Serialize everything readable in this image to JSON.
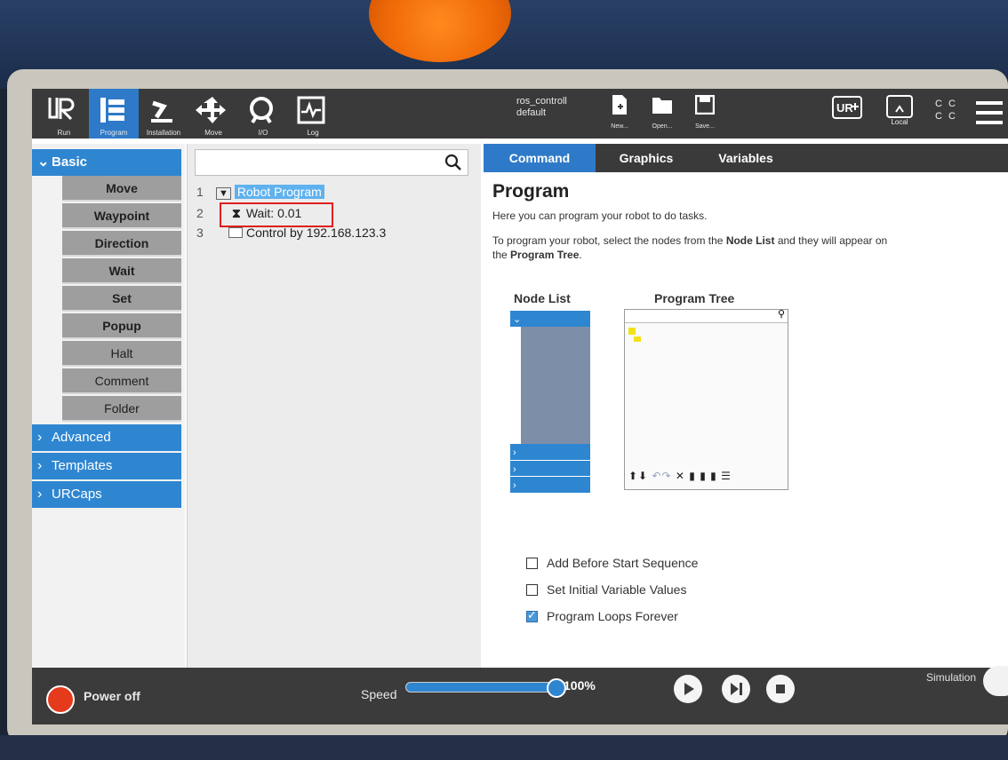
{
  "header": {
    "nav": [
      {
        "label": "Run",
        "icon": "ur-logo-icon"
      },
      {
        "label": "Program",
        "icon": "program-icon",
        "active": true
      },
      {
        "label": "Installation",
        "icon": "installation-icon"
      },
      {
        "label": "Move",
        "icon": "move-icon"
      },
      {
        "label": "I/O",
        "icon": "io-icon"
      },
      {
        "label": "Log",
        "icon": "log-icon"
      }
    ],
    "program_name": "ros_controll",
    "installation_name": "default",
    "file_buttons": [
      {
        "label": "New...",
        "icon": "new-file-icon"
      },
      {
        "label": "Open...",
        "icon": "open-folder-icon"
      },
      {
        "label": "Save...",
        "icon": "save-icon"
      }
    ],
    "local_label": "Local",
    "cc_top": "C C",
    "cc_bottom": "C C"
  },
  "sidebar": {
    "categories": [
      {
        "label": "Basic",
        "expanded": true
      },
      {
        "label": "Advanced"
      },
      {
        "label": "Templates"
      },
      {
        "label": "URCaps"
      }
    ],
    "basic_items": [
      "Move",
      "Waypoint",
      "Direction",
      "Wait",
      "Set",
      "Popup",
      "Halt",
      "Comment",
      "Folder"
    ]
  },
  "tree": {
    "rows": [
      {
        "num": "1",
        "label": "Robot Program",
        "selected": true
      },
      {
        "num": "2",
        "label": "Wait: 0.01"
      },
      {
        "num": "3",
        "label": "Control by 192.168.123.3"
      }
    ]
  },
  "tabs": [
    {
      "label": "Command",
      "active": true
    },
    {
      "label": "Graphics"
    },
    {
      "label": "Variables"
    }
  ],
  "command": {
    "title": "Program",
    "line1": "Here you can program your robot to do tasks.",
    "line2_a": "To program your robot, select the nodes from the ",
    "line2_b": "Node List",
    "line2_c": " and they will appear on",
    "line3_a": "the ",
    "line3_b": "Program Tree",
    "line3_c": ".",
    "node_list_title": "Node List",
    "program_tree_title": "Program Tree",
    "options": [
      {
        "label": "Add Before Start Sequence",
        "checked": false
      },
      {
        "label": "Set Initial Variable Values",
        "checked": false
      },
      {
        "label": "Program Loops Forever",
        "checked": true
      }
    ]
  },
  "footer": {
    "power_label": "Power off",
    "speed_label": "Speed",
    "speed_value": "100%",
    "speed_fraction": 1.0,
    "simulation_label": "Simulation"
  },
  "colors": {
    "accent": "#2e86d1",
    "header_bg": "#3a3a3a",
    "power": "#e63a1c"
  }
}
